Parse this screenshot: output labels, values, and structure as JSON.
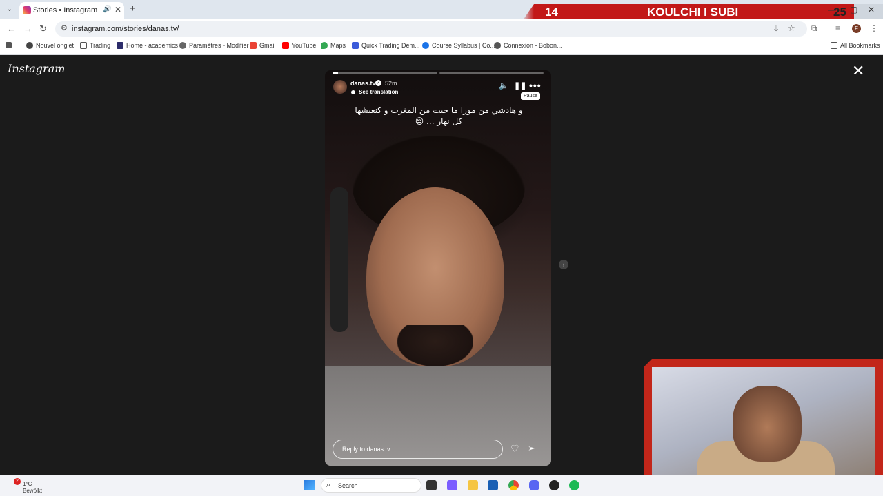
{
  "browser": {
    "tab_title": "Stories • Instagram",
    "url": "instagram.com/stories/danas.tv/",
    "bookmarks": [
      "Nouvel onglet",
      "Trading",
      "Home - academics",
      "Paramètres - Modifier",
      "Gmail",
      "YouTube",
      "Maps",
      "Quick Trading Dem...",
      "Course Syllabus | Co...",
      "Connexion - Bobon..."
    ],
    "all_bookmarks": "All Bookmarks",
    "profile_initial": "F"
  },
  "overlay": {
    "left": "14",
    "mid": "KOULCHI I SUBI",
    "right": "25"
  },
  "page": {
    "logo": "Instagram",
    "story": {
      "username": "danas.tv",
      "time": "52m",
      "see_translation": "See translation",
      "caption": "و هادشي من مورا ما جيت من المغرب و كنعيشها كل نهار ... 😔",
      "tooltip": "Pause",
      "reply_placeholder": "Reply to danas.tv...",
      "progress": [
        0.05,
        0
      ]
    }
  },
  "taskbar": {
    "weather_temp": "1°C",
    "weather_desc": "Bewölkt",
    "notif_count": "2",
    "search_label": "Search"
  },
  "colors": {
    "overlay_red": "#c21818",
    "page_bg": "#1b1b1b"
  }
}
